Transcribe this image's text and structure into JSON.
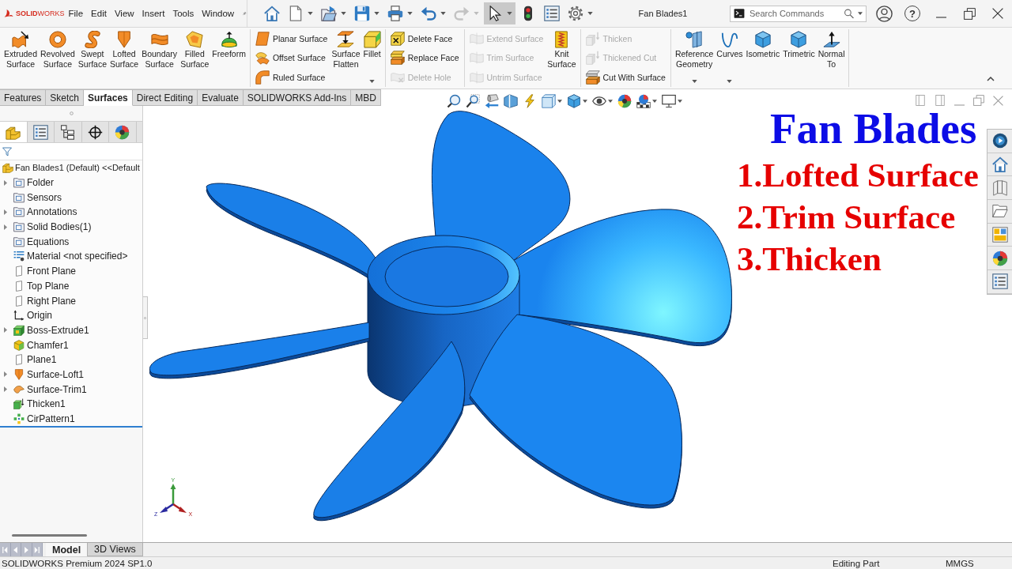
{
  "app": {
    "logo": "**SOLID**WORKS",
    "help": "?"
  },
  "menu": [
    "File",
    "Edit",
    "View",
    "Insert",
    "Tools",
    "Window"
  ],
  "quick_access": [
    {
      "selected": false,
      "disabled": false
    },
    {
      "selected": false,
      "disabled": false
    },
    {
      "selected": false,
      "disabled": false
    },
    {
      "selected": false,
      "disabled": false
    },
    {
      "selected": false,
      "disabled": false
    },
    {
      "selected": false,
      "disabled": false
    },
    {
      "selected": false,
      "disabled": true
    },
    {
      "selected": true,
      "disabled": false
    },
    {
      "selected": false,
      "disabled": false
    },
    {
      "selected": false,
      "disabled": false
    },
    {
      "selected": false,
      "disabled": false
    }
  ],
  "document_title": "Fan Blades1",
  "search": {
    "placeholder": "Search Commands"
  },
  "ribbon": {
    "groups": [
      {
        "items": [
          {
            "kind": "large",
            "label": "Extruded Surface",
            "disabled": false,
            "dropdown": false
          },
          {
            "kind": "large",
            "label": "Revolved Surface",
            "disabled": false,
            "dropdown": false
          },
          {
            "kind": "large",
            "label": "Swept Surface",
            "disabled": false,
            "dropdown": false
          },
          {
            "kind": "large",
            "label": "Lofted Surface",
            "disabled": false,
            "dropdown": false
          },
          {
            "kind": "large",
            "label": "Boundary Surface",
            "disabled": false,
            "dropdown": false
          },
          {
            "kind": "large",
            "label": "Filled Surface",
            "disabled": false,
            "dropdown": false
          },
          {
            "kind": "large",
            "label": "Freeform",
            "disabled": false,
            "dropdown": false
          }
        ]
      },
      {
        "items": [
          {
            "kind": "small",
            "label": "Planar Surface",
            "disabled": false,
            "dropdown": false
          },
          {
            "kind": "small",
            "label": "Offset Surface",
            "disabled": false,
            "dropdown": false
          },
          {
            "kind": "small",
            "label": "Ruled Surface",
            "disabled": false,
            "dropdown": false
          },
          {
            "kind": "large",
            "label": "Surface Flatten",
            "disabled": false,
            "dropdown": false
          },
          {
            "kind": "large",
            "label": "Fillet",
            "disabled": false,
            "dropdown": true
          }
        ]
      },
      {
        "items": [
          {
            "kind": "small",
            "label": "Delete Face",
            "disabled": false,
            "dropdown": false
          },
          {
            "kind": "small",
            "label": "Replace Face",
            "disabled": false,
            "dropdown": false
          },
          {
            "kind": "small",
            "label": "Delete Hole",
            "disabled": true,
            "dropdown": false
          }
        ]
      },
      {
        "items": [
          {
            "kind": "small",
            "label": "Extend Surface",
            "disabled": true,
            "dropdown": false
          },
          {
            "kind": "small",
            "label": "Trim Surface",
            "disabled": true,
            "dropdown": false
          },
          {
            "kind": "small",
            "label": "Untrim Surface",
            "disabled": true,
            "dropdown": false
          },
          {
            "kind": "large",
            "label": "Knit Surface",
            "disabled": false,
            "dropdown": false
          }
        ]
      },
      {
        "items": [
          {
            "kind": "small",
            "label": "Thicken",
            "disabled": true,
            "dropdown": false
          },
          {
            "kind": "small",
            "label": "Thickened Cut",
            "disabled": true,
            "dropdown": false
          },
          {
            "kind": "small",
            "label": "Cut With Surface",
            "disabled": false,
            "dropdown": false
          }
        ]
      },
      {
        "items": [
          {
            "kind": "large",
            "label": "Reference Geometry",
            "disabled": false,
            "dropdown": true
          },
          {
            "kind": "large",
            "label": "Curves",
            "disabled": false,
            "dropdown": true
          },
          {
            "kind": "large",
            "label": "Isometric",
            "disabled": false,
            "dropdown": false
          },
          {
            "kind": "large",
            "label": "Trimetric",
            "disabled": false,
            "dropdown": false
          },
          {
            "kind": "large",
            "label": "Normal To",
            "disabled": false,
            "dropdown": false
          }
        ]
      }
    ]
  },
  "command_tabs": [
    {
      "label": "Features",
      "selected": false
    },
    {
      "label": "Sketch",
      "selected": false
    },
    {
      "label": "Surfaces",
      "selected": true
    },
    {
      "label": "Direct Editing",
      "selected": false
    },
    {
      "label": "Evaluate",
      "selected": false
    },
    {
      "label": "SOLIDWORKS Add-Ins",
      "selected": false
    },
    {
      "label": "MBD",
      "selected": false
    }
  ],
  "feature_manager": {
    "panel_tabs": [
      {
        "selected": true
      },
      {
        "selected": false
      },
      {
        "selected": false
      },
      {
        "selected": false
      },
      {
        "selected": false
      }
    ],
    "tree": {
      "label": "Fan Blades1 (Default) <<Default",
      "kind": "part",
      "children": [
        {
          "label": "Folder",
          "kind": "folder",
          "expandable": true
        },
        {
          "label": "Sensors",
          "kind": "folder",
          "expandable": false
        },
        {
          "label": "Annotations",
          "kind": "folder",
          "expandable": true
        },
        {
          "label": "Solid Bodies(1)",
          "kind": "folder",
          "expandable": true
        },
        {
          "label": "Equations",
          "kind": "folder",
          "expandable": false
        },
        {
          "label": "Material <not specified>",
          "kind": "material",
          "expandable": false
        },
        {
          "label": "Front Plane",
          "kind": "plane",
          "expandable": false
        },
        {
          "label": "Top Plane",
          "kind": "plane",
          "expandable": false
        },
        {
          "label": "Right Plane",
          "kind": "plane",
          "expandable": false
        },
        {
          "label": "Origin",
          "kind": "origin",
          "expandable": false
        },
        {
          "label": "Boss-Extrude1",
          "kind": "extrude",
          "expandable": true
        },
        {
          "label": "Chamfer1",
          "kind": "chamfer",
          "expandable": false
        },
        {
          "label": "Plane1",
          "kind": "plane",
          "expandable": false
        },
        {
          "label": "Surface-Loft1",
          "kind": "loft",
          "expandable": true
        },
        {
          "label": "Surface-Trim1",
          "kind": "trim",
          "expandable": true
        },
        {
          "label": "Thicken1",
          "kind": "thicken",
          "expandable": false
        },
        {
          "label": "CirPattern1",
          "kind": "pattern",
          "expandable": false
        }
      ]
    }
  },
  "viewport": {
    "overlay": {
      "title": "Fan Blades",
      "steps": [
        "1.Lofted Surface",
        "2.Trim Surface",
        "3.Thicken"
      ]
    },
    "triad": {
      "x": "X",
      "y": "Y",
      "z": "Z"
    }
  },
  "bottom_tabs": [
    {
      "label": "Model",
      "selected": true
    },
    {
      "label": "3D Views",
      "selected": false
    }
  ],
  "status_bar": {
    "product": "SOLIDWORKS Premium 2024 SP1.0",
    "mode": "Editing Part",
    "units": "MMGS"
  }
}
